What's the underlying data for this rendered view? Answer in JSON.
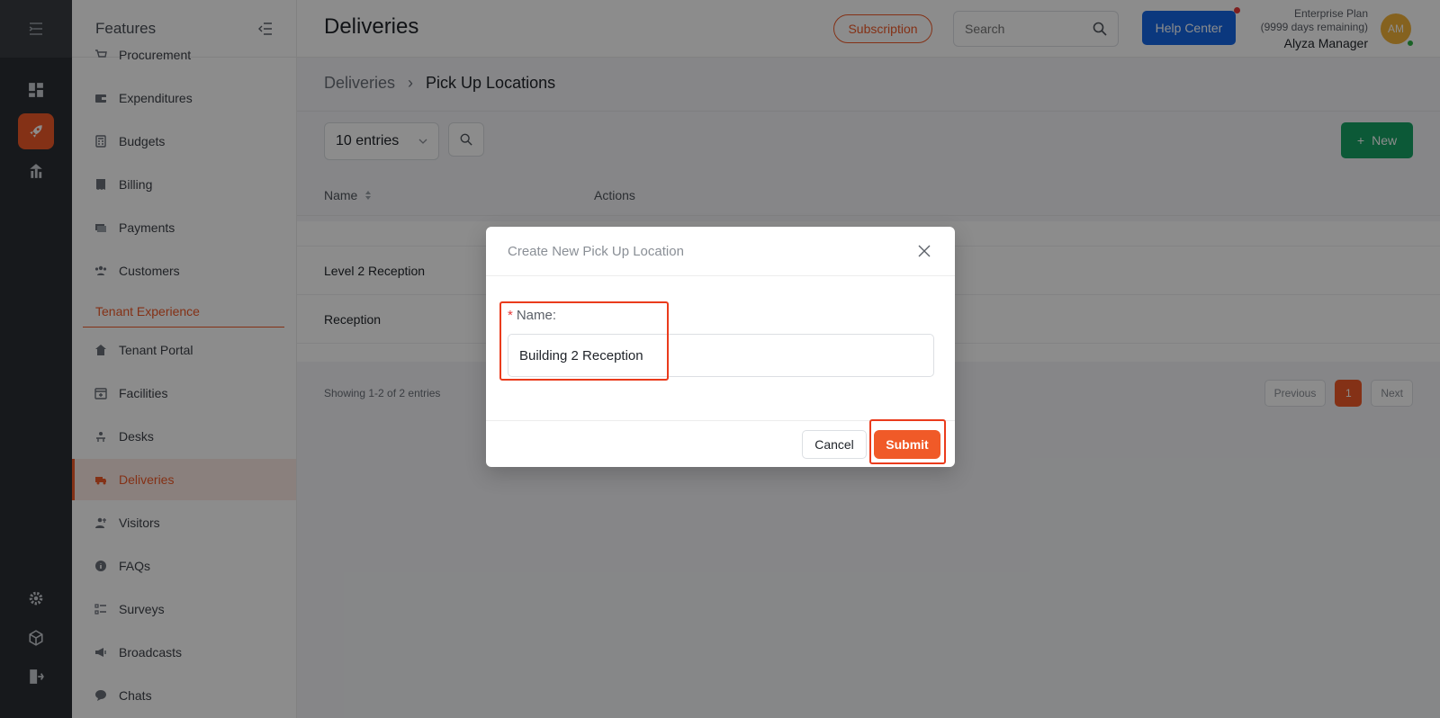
{
  "rail": {
    "items": [
      {
        "icon": "dashboard-icon"
      },
      {
        "icon": "rocket-icon",
        "active": true
      },
      {
        "icon": "building-chart-icon"
      },
      {
        "icon": "gear-icon"
      },
      {
        "icon": "cube-icon"
      },
      {
        "icon": "logout-icon"
      }
    ]
  },
  "features": {
    "title": "Features",
    "items": [
      {
        "label": "Procurement",
        "icon": "cart-icon"
      },
      {
        "label": "Expenditures",
        "icon": "wallet-icon"
      },
      {
        "label": "Budgets",
        "icon": "calculator-icon"
      },
      {
        "label": "Billing",
        "icon": "receipt-icon"
      },
      {
        "label": "Payments",
        "icon": "money-icon"
      },
      {
        "label": "Customers",
        "icon": "users-icon"
      },
      {
        "label": "Tenant Portal",
        "icon": "home-icon"
      },
      {
        "label": "Facilities",
        "icon": "calendar-plus-icon"
      },
      {
        "label": "Desks",
        "icon": "desk-icon"
      },
      {
        "label": "Deliveries",
        "icon": "truck-icon",
        "active": true
      },
      {
        "label": "Visitors",
        "icon": "visitor-icon"
      },
      {
        "label": "FAQs",
        "icon": "info-icon"
      },
      {
        "label": "Surveys",
        "icon": "list-icon"
      },
      {
        "label": "Broadcasts",
        "icon": "megaphone-icon"
      },
      {
        "label": "Chats",
        "icon": "chat-icon"
      }
    ],
    "section_label": "Tenant Experience"
  },
  "header": {
    "title": "Deliveries",
    "subscription_label": "Subscription",
    "search_placeholder": "Search",
    "help_label": "Help Center",
    "plan_line1": "Enterprise Plan",
    "plan_line2": "(9999 days remaining)",
    "user_name": "Alyza Manager",
    "avatar_initials": "AM"
  },
  "content": {
    "breadcrumb": [
      "Deliveries",
      "Pick Up Locations"
    ],
    "entries_label": "10 entries",
    "new_label": "New",
    "columns": [
      "Name",
      "Actions"
    ],
    "rows": [
      "Level 2 Reception",
      "Reception"
    ],
    "showing": "Showing 1-2 of 2 entries",
    "pager": {
      "prev": "Previous",
      "current": "1",
      "next": "Next"
    }
  },
  "modal": {
    "title": "Create New Pick Up Location",
    "field_label": "Name",
    "field_suffix": ":",
    "required_mark": "*",
    "name_value": "Building 2 Reception",
    "cancel_label": "Cancel",
    "submit_label": "Submit"
  },
  "colors": {
    "accent": "#f05a28",
    "primary_blue": "#1467e6",
    "success_green": "#16a364",
    "rail_bg": "#2b2e33",
    "highlight": "#ea3b1c"
  }
}
